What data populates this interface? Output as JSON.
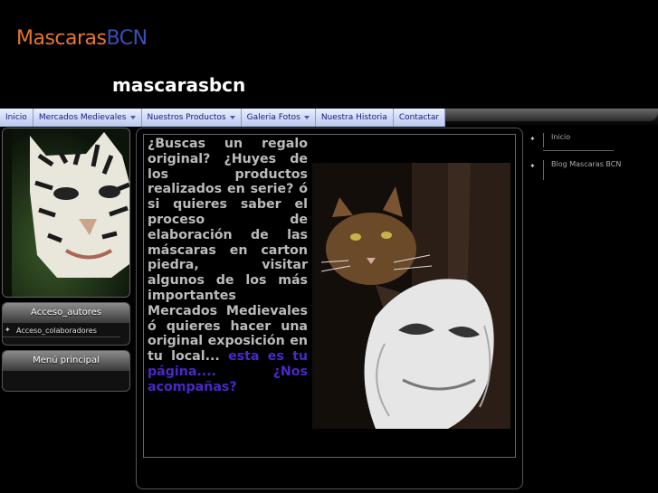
{
  "logo": {
    "part1": "Mascaras",
    "part2": "BCN"
  },
  "site_title": "mascarasbcn",
  "nav": [
    {
      "label": "Inicio",
      "dropdown": false
    },
    {
      "label": "Mercados Medievales",
      "dropdown": true
    },
    {
      "label": "Nuestros Productos",
      "dropdown": true
    },
    {
      "label": "Galeria Fotos",
      "dropdown": true
    },
    {
      "label": "Nuestra Historia",
      "dropdown": false
    },
    {
      "label": "Contactar",
      "dropdown": false
    }
  ],
  "left": {
    "module1": {
      "title": "Acceso_autores",
      "link": "Acceso_colaboradores"
    },
    "module2": {
      "title": "Menú principal"
    }
  },
  "main": {
    "text": "¿Buscas un regalo original? ¿Huyes de los productos realizados en serie? ó si quieres saber el proceso de elaboración de las máscaras en carton piedra, visitar algunos de los más importantes Mercados Medievales ó quieres hacer una original exposición en tu local...",
    "link_text": "esta es tu página.... ¿Nos acompañas?"
  },
  "right": {
    "items": [
      "Inicio",
      "Blog Mascaras BCN"
    ]
  },
  "colors": {
    "logo_orange": "#e8752a",
    "logo_blue": "#3a4fb8",
    "link_purple": "#4a28c8"
  }
}
